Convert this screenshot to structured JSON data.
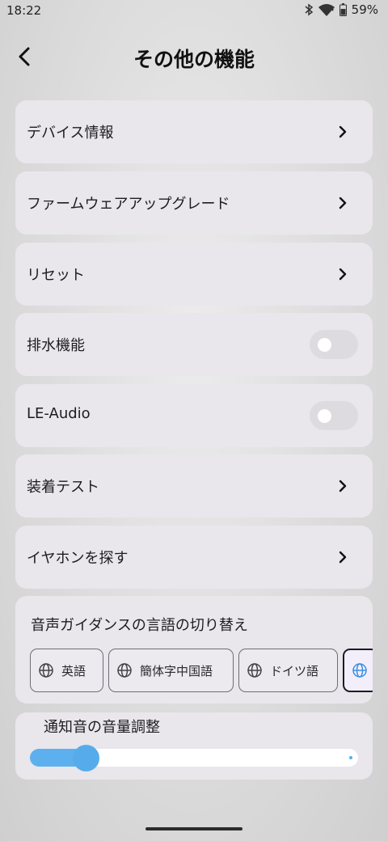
{
  "status": {
    "time": "18:22",
    "battery": "59%",
    "icons": [
      "bluetooth-icon",
      "wifi-icon",
      "battery-icon"
    ]
  },
  "header": {
    "title": "その他の機能",
    "back_icon": "chevron-left-icon"
  },
  "menu": [
    {
      "label": "デバイス情報",
      "type": "link"
    },
    {
      "label": "ファームウェアアップグレード",
      "type": "link"
    },
    {
      "label": "リセット",
      "type": "link"
    },
    {
      "label": "排水機能",
      "type": "toggle",
      "on": false
    },
    {
      "label": "LE-Audio",
      "type": "toggle",
      "on": false
    },
    {
      "label": "装着テスト",
      "type": "link"
    },
    {
      "label": "イヤホンを探す",
      "type": "link"
    }
  ],
  "language": {
    "title": "音声ガイダンスの言語の切り替え",
    "options": [
      "英語",
      "簡体字中国語",
      "ドイツ語",
      ""
    ],
    "selected_index": 3
  },
  "volume": {
    "title": "通知音の音量調整",
    "level_fraction": 0.17
  },
  "colors": {
    "accent": "#5db0ee",
    "card": "#e9e6ec"
  }
}
